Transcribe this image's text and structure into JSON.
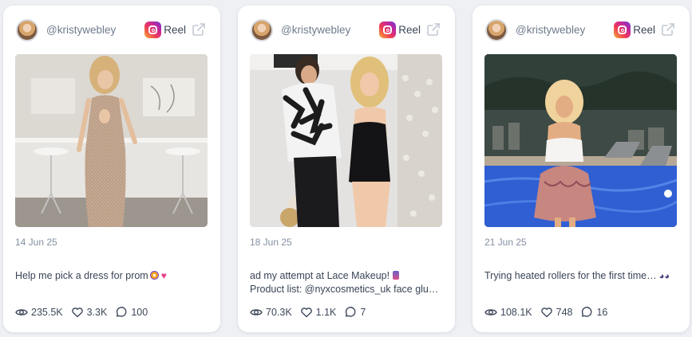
{
  "posts": [
    {
      "username": "@kristywebley",
      "platform_icon": "instagram-icon",
      "type_label": "Reel",
      "date": "14 Jun 25",
      "caption_lines": [
        "Help me pick a dress for prom"
      ],
      "caption_emoji": [
        "emoji-icon",
        "pink-heart-icon"
      ],
      "views": "235.5K",
      "likes": "3.3K",
      "comments": "100"
    },
    {
      "username": "@kristywebley",
      "platform_icon": "instagram-icon",
      "type_label": "Reel",
      "date": "18 Jun 25",
      "caption_lines": [
        "ad my attempt at Lace Makeup!",
        "Product list: @nyxcosmetics_uk face glu…"
      ],
      "caption_emoji": [
        "thread-icon"
      ],
      "views": "70.3K",
      "likes": "1.1K",
      "comments": "7"
    },
    {
      "username": "@kristywebley",
      "platform_icon": "instagram-icon",
      "type_label": "Reel",
      "date": "21 Jun 25",
      "caption_lines": [
        "Trying heated rollers for the first time…"
      ],
      "caption_emoji": [
        "eyes-icon"
      ],
      "views": "108.1K",
      "likes": "748",
      "comments": "16"
    }
  ],
  "colors": {
    "card_bg": "#ffffff",
    "page_bg": "#eef0f4",
    "text_primary": "#3a4557",
    "text_muted": "#8390a2"
  }
}
